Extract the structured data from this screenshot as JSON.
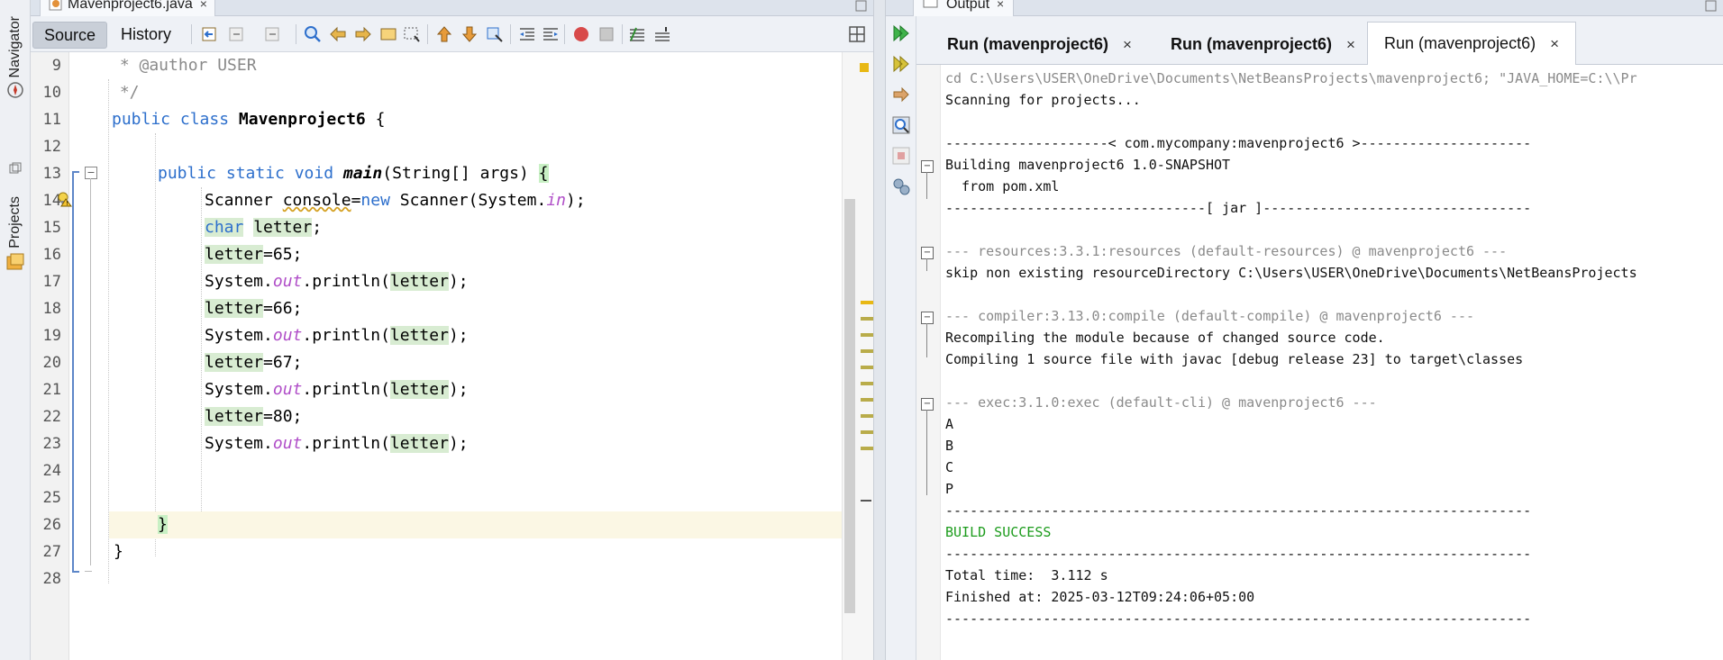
{
  "editor": {
    "file_tab": "Mavenproject6.java",
    "close_symbol": "×",
    "toolbar": {
      "source": "Source",
      "history": "History"
    },
    "line_numbers": [
      "9",
      "10",
      "11",
      "12",
      "13",
      "14",
      "15",
      "16",
      "17",
      "18",
      "19",
      "20",
      "21",
      "22",
      "23",
      "24",
      "25",
      "26",
      "27",
      "28"
    ],
    "code": {
      "l9": " * @author USER",
      "l10": " */",
      "l11_a": "public class ",
      "l11_b": "Mavenproject6",
      "l11_c": " {",
      "l13_a": "public static void ",
      "l13_b": "main",
      "l13_c": "(String[] args) ",
      "l13_d": "{",
      "l14_a": "Scanner ",
      "l14_b": "console",
      "l14_c": "=",
      "l14_d": "new",
      "l14_e": " Scanner(System.",
      "l14_f": "in",
      "l14_g": ");",
      "char_kw": "char",
      "letter": "letter",
      "semi": ";",
      "assign_65": "=65;",
      "assign_66": "=66;",
      "assign_67": "=67;",
      "assign_80": "=80;",
      "sysout_a": "System.",
      "sysout_b": "out",
      "sysout_c": ".println(",
      "sysout_d": ");",
      "brace_close": "}"
    }
  },
  "output": {
    "title": "Output",
    "run_tabs": [
      {
        "label": "Run (mavenproject6)",
        "active": false
      },
      {
        "label": "Run (mavenproject6)",
        "active": false
      },
      {
        "label": "Run (mavenproject6)",
        "active": true
      }
    ],
    "lines": [
      "cd C:\\Users\\USER\\OneDrive\\Documents\\NetBeansProjects\\mavenproject6; \"JAVA_HOME=C:\\\\Pr",
      "Scanning for projects...",
      "",
      "--------------------< com.mycompany:mavenproject6 >---------------------",
      "Building mavenproject6 1.0-SNAPSHOT",
      "  from pom.xml",
      "--------------------------------[ jar ]---------------------------------",
      "",
      "--- resources:3.3.1:resources (default-resources) @ mavenproject6 ---",
      "skip non existing resourceDirectory C:\\Users\\USER\\OneDrive\\Documents\\NetBeansProjects",
      "",
      "--- compiler:3.13.0:compile (default-compile) @ mavenproject6 ---",
      "Recompiling the module because of changed source code.",
      "Compiling 1 source file with javac [debug release 23] to target\\classes",
      "",
      "--- exec:3.1.0:exec (default-cli) @ mavenproject6 ---",
      "A",
      "B",
      "C",
      "P",
      "------------------------------------------------------------------------",
      "BUILD SUCCESS",
      "------------------------------------------------------------------------",
      "Total time:  3.112 s",
      "Finished at: 2025-03-12T09:24:06+05:00",
      "------------------------------------------------------------------------"
    ]
  },
  "sidebar": {
    "navigator": "Navigator",
    "projects": "Projects"
  },
  "colors": {
    "keyword": "#2d6fcc",
    "field": "#b04ec8",
    "success": "#1d9c1d",
    "highlight": "#d8ecd2"
  }
}
